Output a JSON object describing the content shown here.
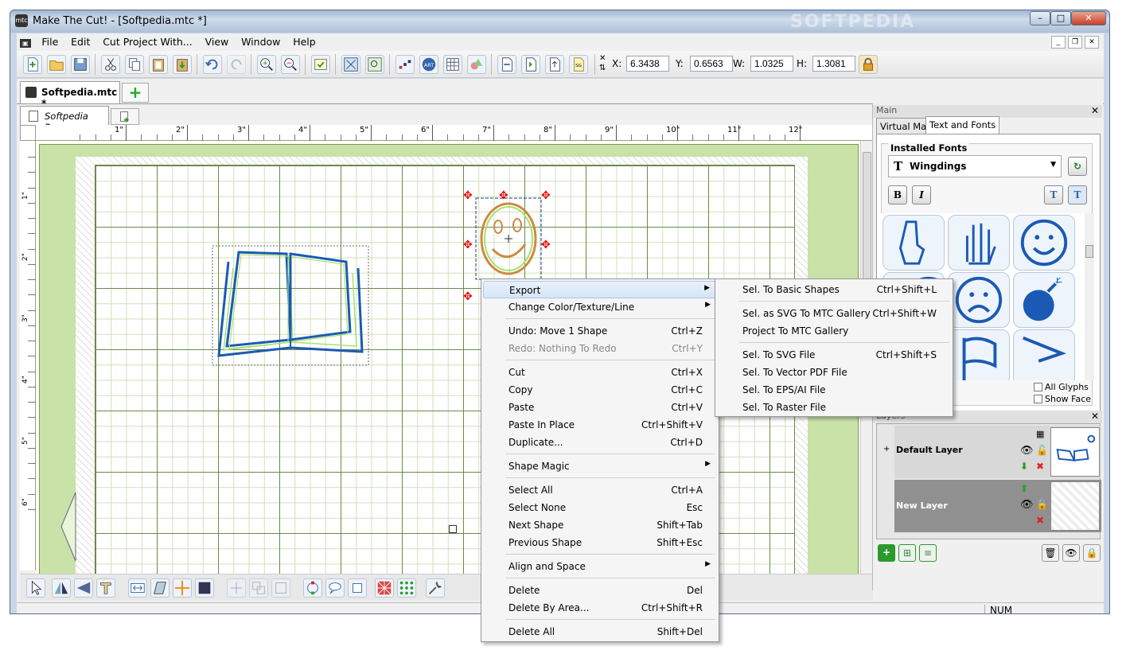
{
  "window": {
    "title": "Make The Cut! - [Softpedia.mtc *]",
    "app_icon": "mtc"
  },
  "menu": [
    "File",
    "Edit",
    "Cut Project With...",
    "View",
    "Window",
    "Help"
  ],
  "coords": {
    "x_label": "X:",
    "x": "6.3438",
    "y_label": "Y:",
    "y": "0.6563",
    "w_label": "W:",
    "w": "1.0325",
    "h_label": "H:",
    "h": "1.3081"
  },
  "doc_tab": "Softpedia.mtc *",
  "page_tab": "Softpedia Page",
  "ruler_h": [
    "1\"",
    "2\"",
    "3\"",
    "4\"",
    "5\"",
    "6\"",
    "7\"",
    "8\"",
    "9\"",
    "10\"",
    "11\"",
    "12\""
  ],
  "ruler_v": [
    "1\"",
    "2\"",
    "3\"",
    "4\"",
    "5\"",
    "6\""
  ],
  "context_menu": [
    {
      "label": "Export",
      "shortcut": "",
      "arrow": "▶",
      "hl": true
    },
    {
      "label": "Change Color/Texture/Line",
      "shortcut": "",
      "arrow": "▶"
    },
    {
      "sep": true
    },
    {
      "label": "Undo: Move 1 Shape",
      "shortcut": "Ctrl+Z"
    },
    {
      "label": "Redo: Nothing To Redo",
      "shortcut": "Ctrl+Y",
      "disabled": true
    },
    {
      "sep": true
    },
    {
      "label": "Cut",
      "shortcut": "Ctrl+X"
    },
    {
      "label": "Copy",
      "shortcut": "Ctrl+C"
    },
    {
      "label": "Paste",
      "shortcut": "Ctrl+V"
    },
    {
      "label": "Paste In Place",
      "shortcut": "Ctrl+Shift+V"
    },
    {
      "label": "Duplicate...",
      "shortcut": "Ctrl+D"
    },
    {
      "sep": true
    },
    {
      "label": "Shape Magic",
      "shortcut": "",
      "arrow": "▶"
    },
    {
      "sep": true
    },
    {
      "label": "Select All",
      "shortcut": "Ctrl+A"
    },
    {
      "label": "Select None",
      "shortcut": "Esc"
    },
    {
      "label": "Next Shape",
      "shortcut": "Shift+Tab"
    },
    {
      "label": "Previous Shape",
      "shortcut": "Shift+Esc"
    },
    {
      "sep": true
    },
    {
      "label": "Align and Space",
      "shortcut": "",
      "arrow": "▶"
    },
    {
      "sep": true
    },
    {
      "label": "Delete",
      "shortcut": "Del"
    },
    {
      "label": "Delete By Area...",
      "shortcut": "Ctrl+Shift+R"
    },
    {
      "sep": true
    },
    {
      "label": "Delete All",
      "shortcut": "Shift+Del"
    }
  ],
  "export_menu": [
    {
      "label": "Sel. To Basic Shapes",
      "shortcut": "Ctrl+Shift+L"
    },
    {
      "sep": true
    },
    {
      "label": "Sel. as SVG To MTC Gallery",
      "shortcut": "Ctrl+Shift+W"
    },
    {
      "label": "Project To MTC Gallery",
      "shortcut": ""
    },
    {
      "sep": true
    },
    {
      "label": "Sel. To SVG File",
      "shortcut": "Ctrl+Shift+S"
    },
    {
      "label": "Sel. To Vector PDF File",
      "shortcut": ""
    },
    {
      "label": "Sel. To EPS/AI File",
      "shortcut": ""
    },
    {
      "label": "Sel. To Raster File",
      "shortcut": ""
    }
  ],
  "side_panel": {
    "header": "Main",
    "tabs": [
      "Virtual Mat",
      "Text and Fonts"
    ],
    "group_title": "Installed Fonts",
    "font": "Wingdings",
    "bold": "B",
    "italic": "I",
    "all_glyphs": "All Glyphs",
    "show_face": "Show Face"
  },
  "layers": {
    "header": "Layers",
    "items": [
      {
        "name": "Default Layer",
        "expander": "+"
      },
      {
        "name": "New Layer"
      }
    ]
  },
  "status": {
    "num": "NUM"
  },
  "watermark": "SOFTPEDIA",
  "accent": "#1a5ab4"
}
